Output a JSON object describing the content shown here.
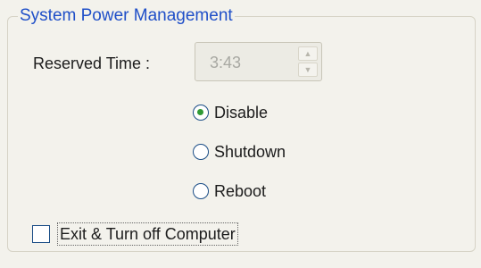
{
  "group": {
    "title": "System Power Management"
  },
  "reserved_time": {
    "label": "Reserved Time :",
    "value": "3:43",
    "enabled": false
  },
  "radio_options": [
    {
      "label": "Disable",
      "selected": true
    },
    {
      "label": "Shutdown",
      "selected": false
    },
    {
      "label": "Reboot",
      "selected": false
    }
  ],
  "checkbox": {
    "label": "Exit & Turn off Computer",
    "checked": false
  },
  "colors": {
    "title": "#1f4fc8",
    "radio_dot": "#2f9a36",
    "control_border": "#1a4d86",
    "background": "#f3f2ec"
  },
  "icons": {
    "spin_up": "up-arrow-icon",
    "spin_down": "down-arrow-icon"
  }
}
